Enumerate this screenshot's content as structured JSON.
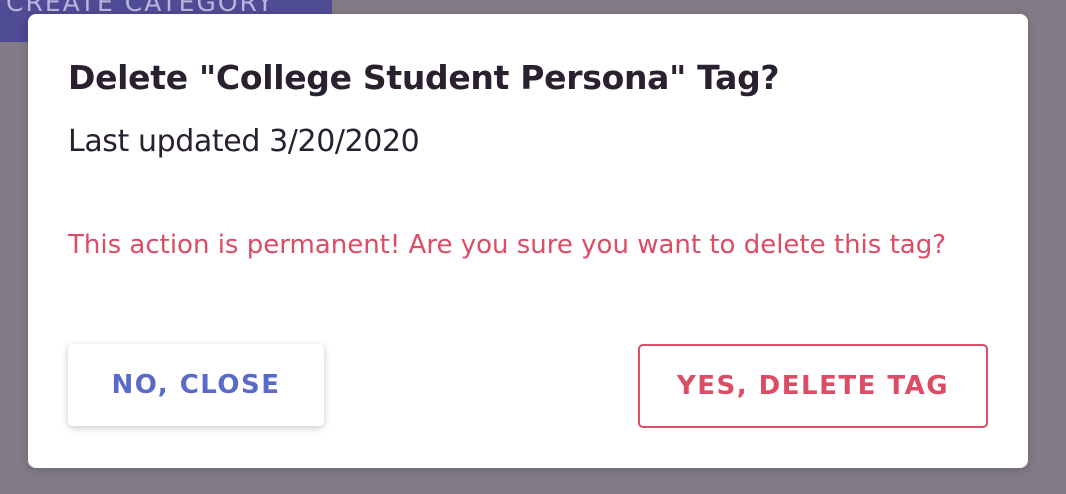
{
  "background": {
    "create_category_label": "CREATE CATEGORY"
  },
  "dialog": {
    "title": "Delete \"College Student Persona\" Tag?",
    "subtitle": "Last updated 3/20/2020",
    "warning": "This action is permanent! Are you sure you want to delete this tag?",
    "cancel_label": "NO, CLOSE",
    "confirm_label": "YES, DELETE TAG"
  },
  "colors": {
    "overlay": "#827b87",
    "accent_primary": "#5a6ac8",
    "danger": "#dc4c64",
    "title_text": "#2a2130",
    "background_button": "#4f4b95"
  }
}
